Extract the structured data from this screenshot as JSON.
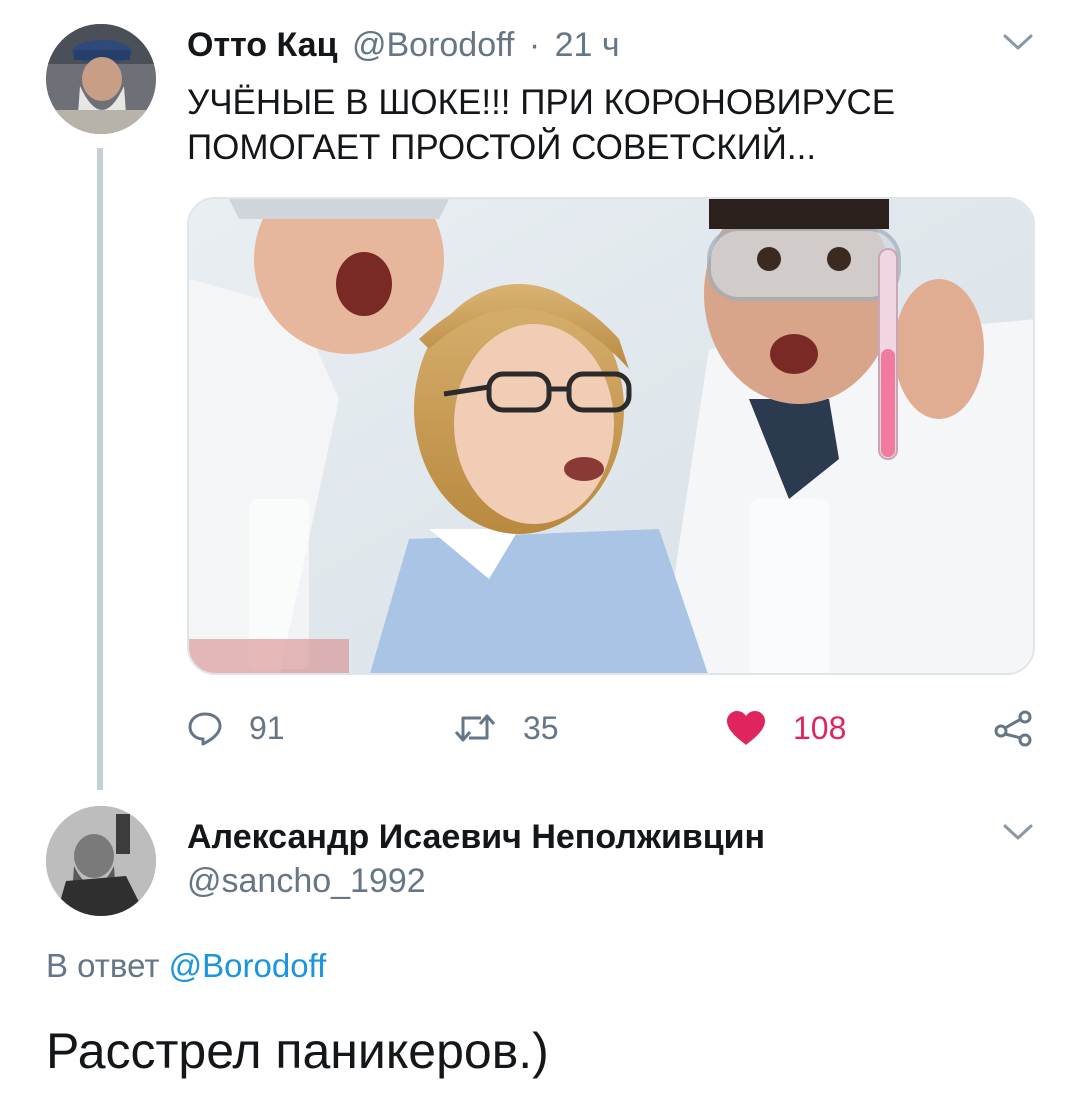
{
  "tweet": {
    "author_name": "Отто Кац",
    "author_handle": "@Borodoff",
    "separator": "·",
    "time": "21 ч",
    "text_line1": "УЧЁНЫЕ В ШОКЕ!!! ПРИ КОРОНОВИРУСЕ",
    "text_line2": "ПОМОГАЕТ ПРОСТОЙ СОВЕТСКИЙ...",
    "replies": "91",
    "retweets": "35",
    "likes": "108",
    "like_color": "#e0245e",
    "muted_color": "#657786",
    "link_color": "#1b95e0"
  },
  "reply": {
    "author_name": "Александр Исаевич Неполживцин",
    "author_handle": "@sancho_1992",
    "reply_to_prefix": "В ответ",
    "reply_to_handle": "@Borodoff",
    "text": "Расстрел паникеров.)"
  },
  "icons": {
    "menu": "chevron-down-icon",
    "reply": "speech-bubble-icon",
    "retweet": "retweet-icon",
    "like": "heart-icon",
    "share": "share-icon"
  }
}
